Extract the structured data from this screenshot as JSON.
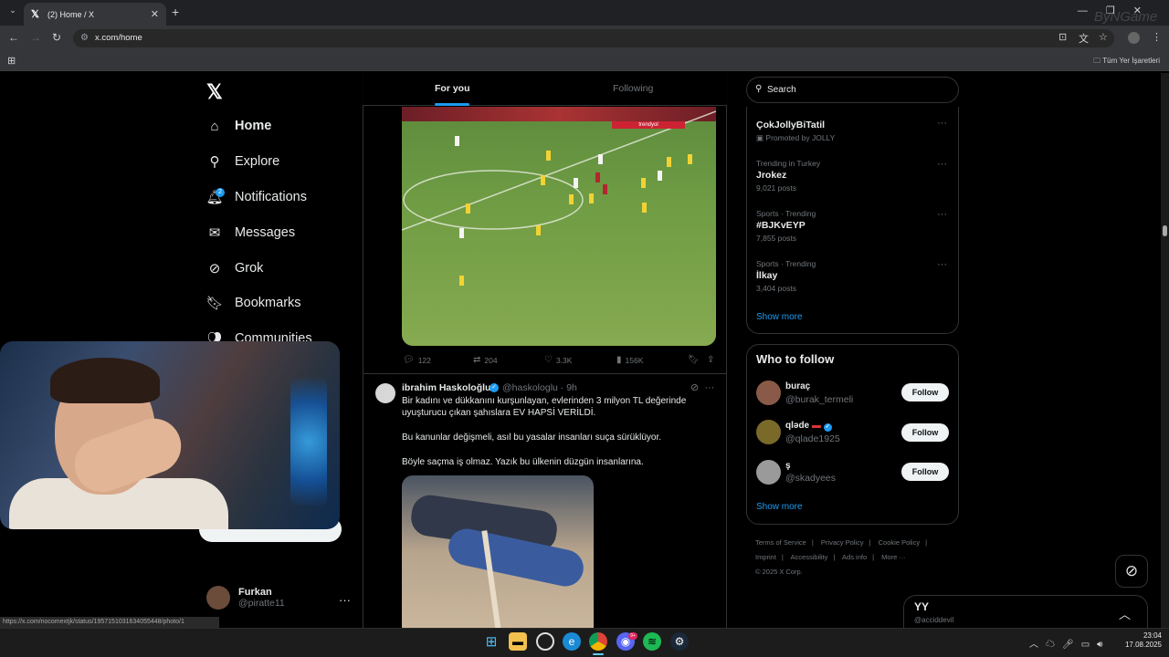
{
  "browser": {
    "tab_title": "(2) Home / X",
    "url": "x.com/home",
    "bookmarks_label": "Tüm Yer İşaretleri",
    "status_url": "https://x.com/nocomextjk/status/1957151031634055448/photo/1"
  },
  "sidebar": {
    "logo": "X",
    "items": [
      {
        "label": "Home",
        "icon": "home-icon"
      },
      {
        "label": "Explore",
        "icon": "search-icon"
      },
      {
        "label": "Notifications",
        "icon": "bell-icon"
      },
      {
        "label": "Messages",
        "icon": "mail-icon"
      },
      {
        "label": "Grok",
        "icon": "grok-icon"
      },
      {
        "label": "Bookmarks",
        "icon": "bookmark-icon"
      },
      {
        "label": "Communities",
        "icon": "people-icon"
      }
    ],
    "notifications_badge": "2",
    "profile": {
      "name": "Furkan",
      "handle": "@piratte11"
    }
  },
  "feed": {
    "tabs": [
      "For you",
      "Following"
    ],
    "post1": {
      "replies": "122",
      "reposts": "204",
      "likes": "3.3K",
      "views": "156K"
    },
    "post2": {
      "name": "ibrahim Haskoloğlu",
      "handle": "@haskologlu",
      "time": "· 9h",
      "text1": "Bir kadını ve dükkanını kurşunlayan, evlerinden 3 milyon TL değerinde uyuşturucu çıkan şahıslara EV HAPSİ VERİLDİ.",
      "text2": "Bu kanunlar değişmeli, asıl bu yasalar insanları suça sürüklüyor.",
      "text3": "Böyle saçma iş olmaz. Yazık bu ülkenin düzgün insanlarına."
    }
  },
  "right": {
    "search_placeholder": "Search",
    "trends": [
      {
        "meta": "Promoted by JOLLY",
        "title": "ÇokJollyBiTatil",
        "count": ""
      },
      {
        "meta": "Trending in Turkey",
        "title": "Jrokez",
        "count": "9,021 posts"
      },
      {
        "meta": "Sports · Trending",
        "title": "#BJKvEYP",
        "count": "7,855 posts"
      },
      {
        "meta": "Sports · Trending",
        "title": "İlkay",
        "count": "3,404 posts"
      }
    ],
    "show_more": "Show more",
    "who_to_follow": "Who to follow",
    "follow": [
      {
        "name": "buraç",
        "handle": "@burak_termeli"
      },
      {
        "name": "qləde",
        "handle": "@qlade1925"
      },
      {
        "name": "ş",
        "handle": "@skadyees"
      }
    ],
    "follow_label": "Follow",
    "footer": [
      "Terms of Service",
      "Privacy Policy",
      "Cookie Policy",
      "Imprint",
      "Accessibility",
      "Ads info",
      "More ···",
      "© 2025 X Corp."
    ],
    "messages": {
      "title": "YY",
      "sub": "@acciddevil"
    }
  },
  "taskbar": {
    "time": "23:04",
    "date": "17.08.2025",
    "discord_badge": "9+"
  },
  "overlay": {
    "watermark": "ByNGame"
  }
}
